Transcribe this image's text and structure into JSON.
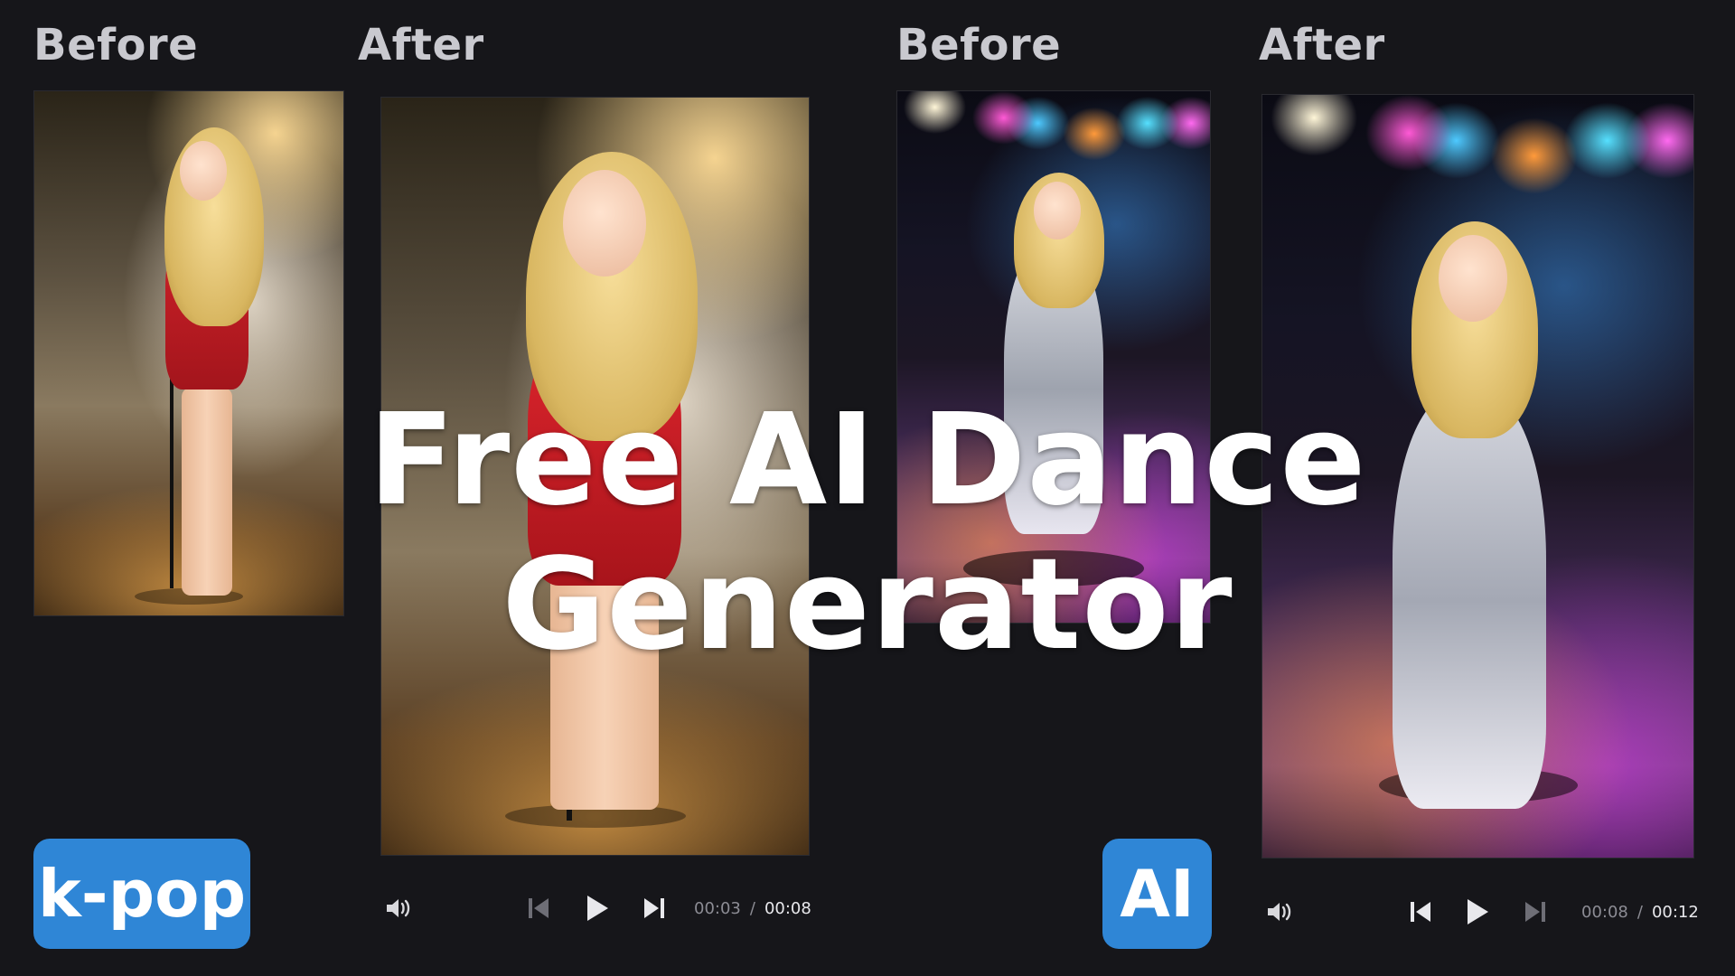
{
  "headline": "Free AI Dance Generator",
  "columns": {
    "left_before_label": "Before",
    "left_after_label": "After",
    "right_before_label": "Before",
    "right_after_label": "After"
  },
  "tags": {
    "left": "k-pop",
    "right": "AI"
  },
  "players": {
    "left": {
      "current_time": "00:03",
      "separator": "/",
      "duration": "00:08"
    },
    "right": {
      "current_time": "00:08",
      "separator": "/",
      "duration": "00:12"
    }
  },
  "colors": {
    "background": "#16161a",
    "label_gray": "#c9c9cf",
    "tag_blue": "#2f86d6",
    "headline_white": "#ffffff"
  },
  "icons": [
    "volume-icon",
    "skip-previous-icon",
    "play-icon",
    "skip-next-icon"
  ]
}
